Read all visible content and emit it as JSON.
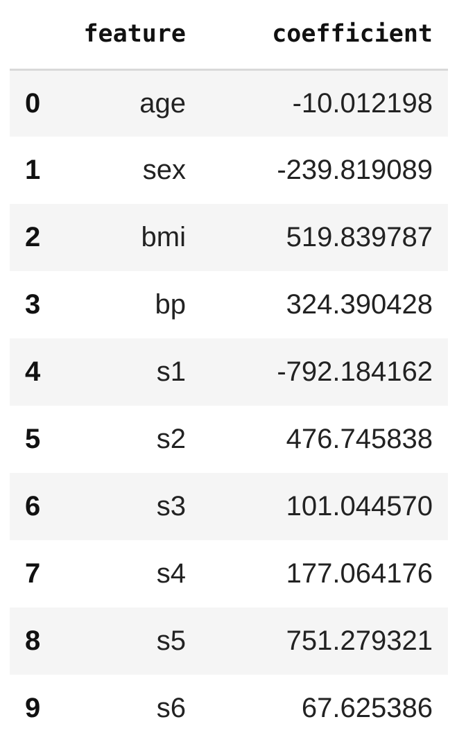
{
  "table": {
    "columns": [
      "",
      "feature",
      "coefficient"
    ],
    "rows": [
      {
        "index": "0",
        "feature": "age",
        "coefficient": "-10.012198"
      },
      {
        "index": "1",
        "feature": "sex",
        "coefficient": "-239.819089"
      },
      {
        "index": "2",
        "feature": "bmi",
        "coefficient": "519.839787"
      },
      {
        "index": "3",
        "feature": "bp",
        "coefficient": "324.390428"
      },
      {
        "index": "4",
        "feature": "s1",
        "coefficient": "-792.184162"
      },
      {
        "index": "5",
        "feature": "s2",
        "coefficient": "476.745838"
      },
      {
        "index": "6",
        "feature": "s3",
        "coefficient": "101.044570"
      },
      {
        "index": "7",
        "feature": "s4",
        "coefficient": "177.064176"
      },
      {
        "index": "8",
        "feature": "s5",
        "coefficient": "751.279321"
      },
      {
        "index": "9",
        "feature": "s6",
        "coefficient": "67.625386"
      }
    ]
  },
  "colors": {
    "stripe": "#f5f5f5",
    "header_rule": "#d9d9d9",
    "text": "#1b1b1b"
  }
}
